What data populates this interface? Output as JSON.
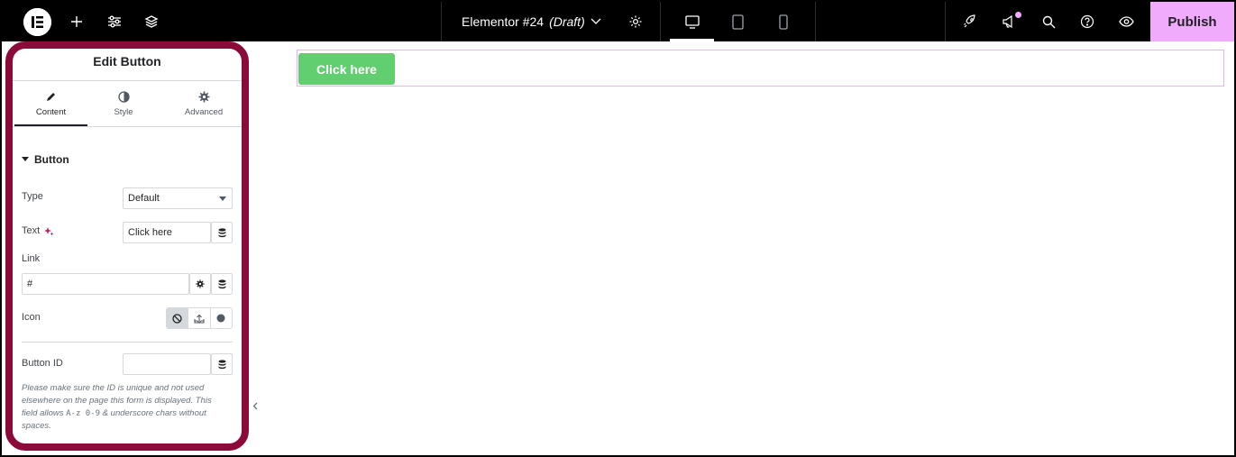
{
  "topbar": {
    "logo_icon": "elementor-logo-icon",
    "add_icon": "plus-icon",
    "settings_icon": "sliders-icon",
    "structure_icon": "layers-icon",
    "document_title": "Elementor #24",
    "document_status": "(Draft)",
    "page_settings_icon": "gear-icon",
    "devices": [
      "desktop-icon",
      "tablet-icon",
      "mobile-icon"
    ],
    "active_device": "desktop",
    "right_icons": [
      "rocket-icon",
      "megaphone-icon",
      "search-icon",
      "help-icon",
      "eye-icon"
    ],
    "publish_label": "Publish",
    "accent_color": "#f0abfc"
  },
  "panel": {
    "title": "Edit Button",
    "tabs": [
      {
        "label": "Content",
        "icon": "pencil-icon",
        "active": true
      },
      {
        "label": "Style",
        "icon": "half-circle-icon",
        "active": false
      },
      {
        "label": "Advanced",
        "icon": "gear-icon",
        "active": false
      }
    ],
    "section_title": "Button",
    "controls": {
      "type": {
        "label": "Type",
        "value": "Default"
      },
      "text": {
        "label": "Text",
        "value": "Click here"
      },
      "link": {
        "label": "Link",
        "value": "#"
      },
      "icon": {
        "label": "Icon",
        "options": [
          "none-icon",
          "upload-icon",
          "circle-icon"
        ],
        "selected": "none"
      },
      "button_id": {
        "label": "Button ID",
        "value": ""
      }
    },
    "help_text_1": "Please make sure the ID is unique and not used elsewhere on the page this form is displayed. This field allows ",
    "help_text_code": "A-z 0-9",
    "help_text_2": " & underscore chars without spaces."
  },
  "canvas": {
    "button_label": "Click here",
    "button_color": "#61ce70"
  }
}
